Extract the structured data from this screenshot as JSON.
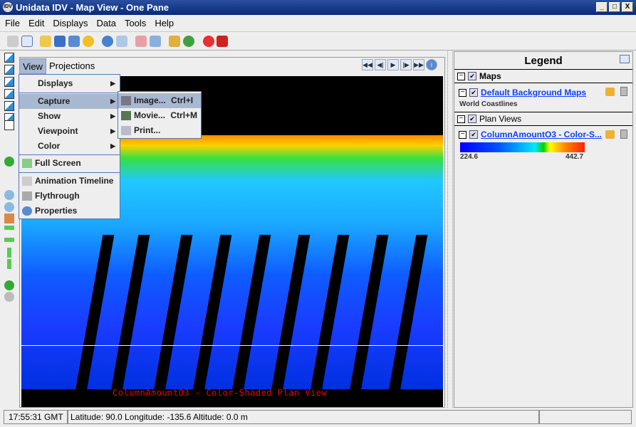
{
  "window": {
    "title": "Unidata IDV - Map View - One Pane",
    "minimize": "_",
    "maximize": "□",
    "close": "X"
  },
  "menubar": [
    "File",
    "Edit",
    "Displays",
    "Data",
    "Tools",
    "Help"
  ],
  "view_menu": {
    "view": "View",
    "projections": "Projections"
  },
  "dropdown": {
    "items": [
      "Displays",
      "Capture",
      "Show",
      "Viewpoint",
      "Color",
      "Full Screen",
      "Animation Timeline",
      "Flythrough",
      "Properties"
    ],
    "arrow": "▶"
  },
  "submenu": {
    "items": [
      {
        "label": "Image...",
        "shortcut": "Ctrl+I"
      },
      {
        "label": "Movie...",
        "shortcut": "Ctrl+M"
      },
      {
        "label": "Print...",
        "shortcut": ""
      }
    ]
  },
  "animation": {
    "buttons": [
      "◀◀",
      "◀|",
      "▶",
      "|▶",
      "▶▶",
      "i"
    ]
  },
  "map": {
    "label": "ColumnAmountO3 - Color-Shaded Plan View"
  },
  "legend": {
    "title": "Legend",
    "maps_header": "Maps",
    "maps_item": "Default Background Maps",
    "maps_sub": "World Coastlines",
    "plan_header": "Plan Views",
    "plan_item": "ColumnAmountO3 - Color-S...",
    "min": "224.6",
    "max": "442.7",
    "toggle": "−",
    "check": "✔"
  },
  "status": {
    "time": "17:55:31 GMT",
    "position": "Latitude:  90.0  Longitude: -135.6  Altitude: 0.0 m"
  }
}
